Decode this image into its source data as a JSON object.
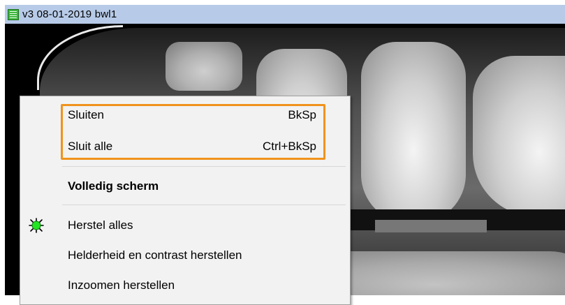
{
  "window": {
    "title": "v3  08-01-2019  bwl1",
    "icon": "spreadsheet-icon"
  },
  "menu": {
    "items": [
      {
        "label": "Sluiten",
        "shortcut": "BkSp"
      },
      {
        "label": "Sluit alle",
        "shortcut": "Ctrl+BkSp"
      },
      {
        "label": "Volledig scherm",
        "shortcut": ""
      },
      {
        "label": "Herstel alles",
        "shortcut": "",
        "icon": "green-bug-icon"
      },
      {
        "label": "Helderheid en contrast herstellen",
        "shortcut": ""
      },
      {
        "label": "Inzoomen herstellen",
        "shortcut": ""
      }
    ],
    "highlight_color": "#f0931c"
  }
}
